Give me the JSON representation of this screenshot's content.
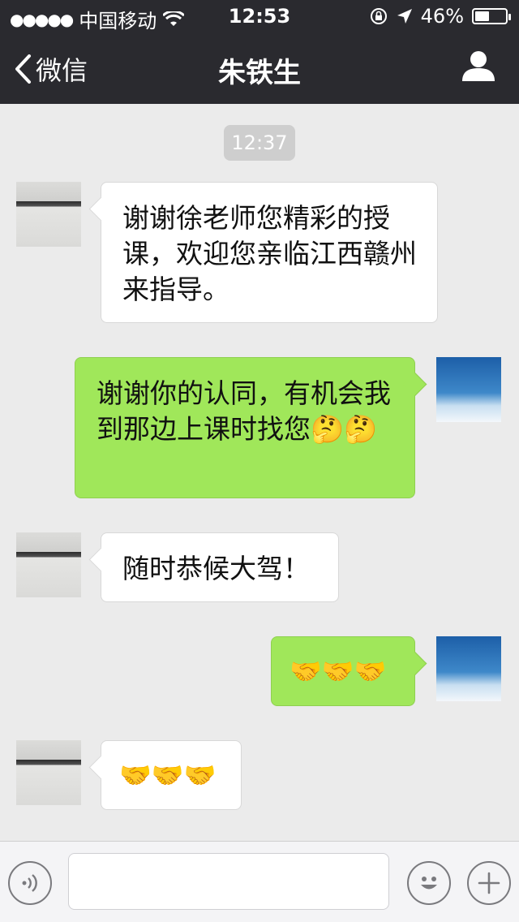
{
  "status_bar": {
    "carrier": "中国移动",
    "time": "12:53",
    "battery": "46%",
    "battery_level": 0.46
  },
  "nav": {
    "back_label": "微信",
    "title": "朱铁生"
  },
  "chat": {
    "timestamp": "12:37",
    "messages": [
      {
        "from": "theirs",
        "text": "谢谢徐老师您精彩的授课，欢迎您亲临江西赣州来指导。"
      },
      {
        "from": "mine",
        "text": "谢谢你的认同，有机会我到那边上课时找您🤔🤔"
      },
      {
        "from": "theirs",
        "text": "随时恭候大驾！"
      },
      {
        "from": "mine",
        "text": "🤝🤝🤝"
      },
      {
        "from": "theirs",
        "text": "🤝🤝🤝"
      }
    ]
  },
  "input_bar": {
    "message_value": ""
  },
  "icons": {
    "back": "chevron-left-icon",
    "profile": "person-icon",
    "voice": "voice-icon",
    "emoji": "smiley-icon",
    "plus": "plus-icon"
  },
  "colors": {
    "nav_bg": "#2a2a2f",
    "chat_bg": "#ebebeb",
    "mine_bubble": "#a0e75a",
    "theirs_bubble": "#ffffff"
  }
}
